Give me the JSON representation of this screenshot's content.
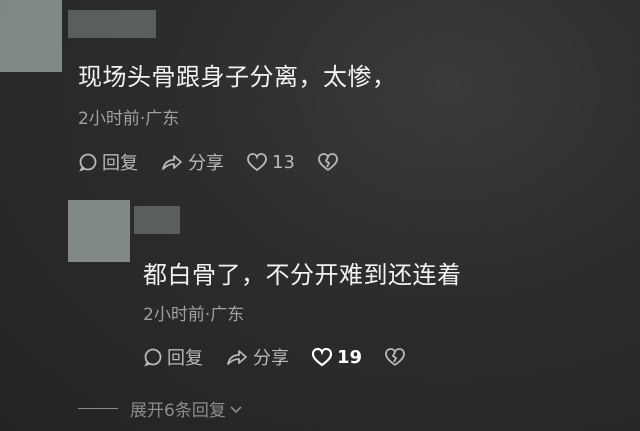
{
  "comment1": {
    "text": "现场头骨跟身子分离，太惨，",
    "meta": "2小时前·广东",
    "reply_label": "回复",
    "share_label": "分享",
    "like_count": "13"
  },
  "comment2": {
    "text": "都白骨了，不分开难到还连着",
    "meta": "2小时前·广东",
    "reply_label": "回复",
    "share_label": "分享",
    "like_count": "19"
  },
  "expand_label": "展开6条回复",
  "icons": [
    "comment-bubble-icon",
    "share-arrow-icon",
    "heart-icon",
    "broken-heart-icon",
    "chevron-down-icon"
  ]
}
